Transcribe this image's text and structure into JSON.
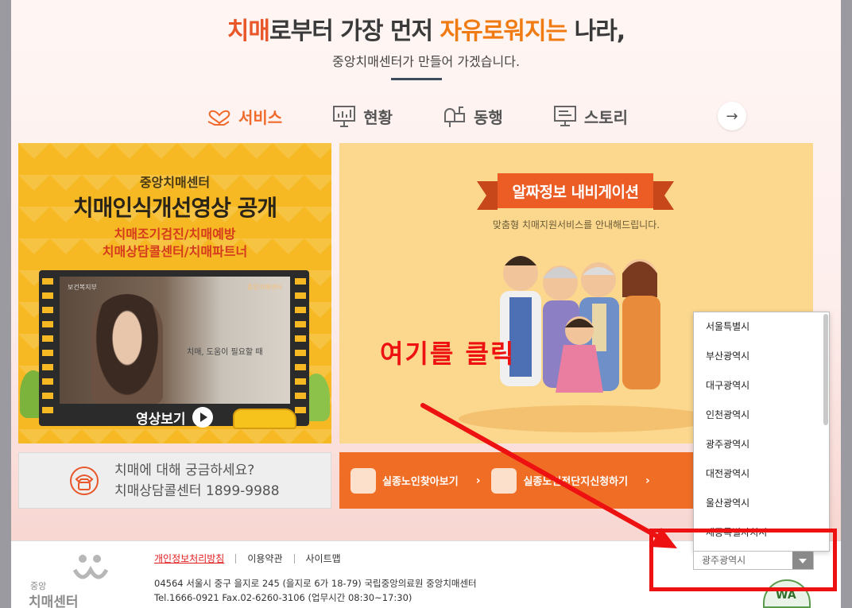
{
  "headline": {
    "part1": "치매",
    "part2": "로부터 가장 먼저 ",
    "part3": "자유로워지는",
    "part4": " 나라,"
  },
  "subline": "중앙치매센터가 만들어 가겠습니다.",
  "tabs": [
    {
      "label": "서비스",
      "icon": "heart-hand-icon",
      "active": true
    },
    {
      "label": "현황",
      "icon": "presentation-chart-icon",
      "active": false
    },
    {
      "label": "동행",
      "icon": "mailbox-icon",
      "active": false
    },
    {
      "label": "스토리",
      "icon": "monitor-icon",
      "active": false
    }
  ],
  "next_button": "→",
  "banner_left": {
    "org": "중앙치매센터",
    "title": "치매인식개선영상 공개",
    "sub1": "치매조기검진/치매예방",
    "sub2": "치매상담콜센터/치매파트너",
    "screen_logo_left": "보건복지부",
    "screen_logo_right": "중앙치매센터",
    "screen_caption": "치매, 도움이 필요할 때",
    "watch_label": "영상보기"
  },
  "banner_right": {
    "ribbon": "알짜정보 내비게이션",
    "sub": "맞춤형 치매지원서비스를 안내해드립니다."
  },
  "call_box": {
    "line1": "치매에 대해 궁금하세요?",
    "line2": "치매상담콜센터 1899-9988"
  },
  "orange_bar": {
    "item1": "실종노인찾아보기",
    "item2": "실종노인전단지신청하기"
  },
  "footer": {
    "logo_line1": "중앙",
    "logo_line2": "치매센터",
    "links": [
      "개인정보처리방침",
      "이용약관",
      "사이트맵"
    ],
    "address": "04564 서울시 중구 을지로 245 (을지로 6가 18-79) 국립중앙의료원 중앙치매센터",
    "tel": "Tel.1666-0921 Fax.02-6260-3106 (업무시간 08:30~17:30)",
    "badge": "WA"
  },
  "dropdown": {
    "options": [
      "서울특별시",
      "부산광역시",
      "대구광역시",
      "인천광역시",
      "광주광역시",
      "대전광역시",
      "울산광역시",
      "세종특별자치시"
    ],
    "selected": "광주광역시"
  },
  "annotation": "여기를 클릭",
  "colors": {
    "accent_orange": "#ef6a2b",
    "annotation_red": "#ee1111",
    "banner_yellow": "#f6b924"
  }
}
